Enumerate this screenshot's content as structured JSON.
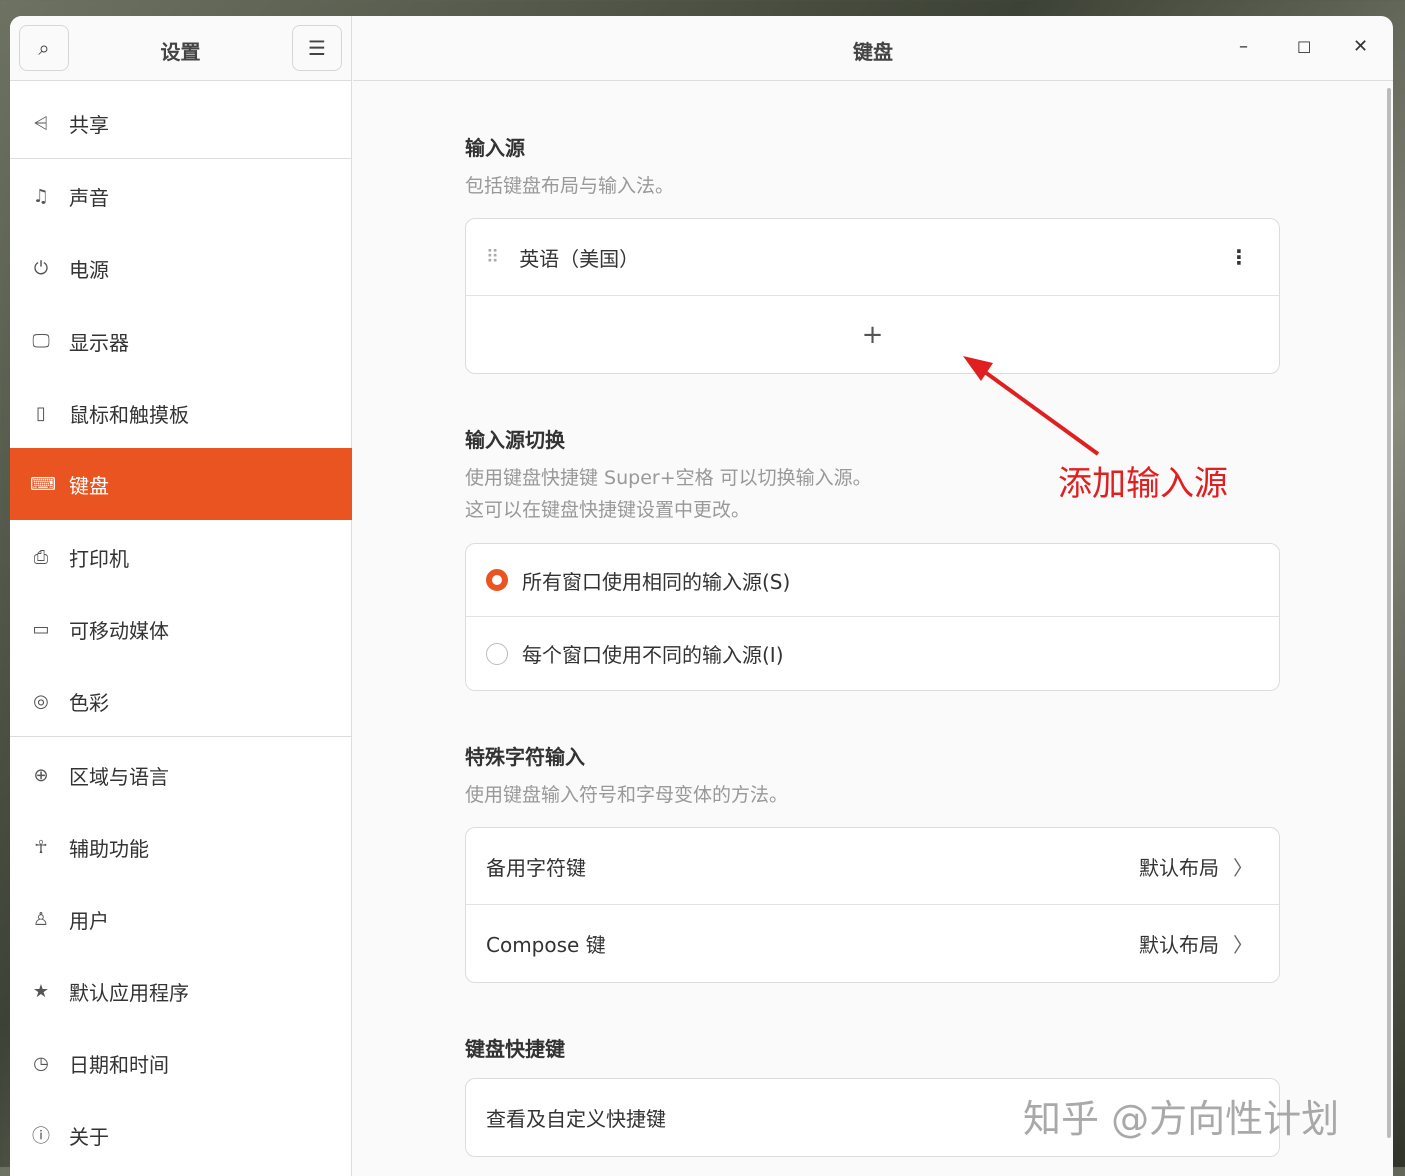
{
  "sidebar": {
    "title": "设置",
    "items": [
      {
        "label": "共享",
        "icon": "share-icon"
      },
      {
        "label": "声音",
        "icon": "music-note-icon"
      },
      {
        "label": "电源",
        "icon": "power-icon"
      },
      {
        "label": "显示器",
        "icon": "display-icon"
      },
      {
        "label": "鼠标和触摸板",
        "icon": "mouse-icon"
      },
      {
        "label": "键盘",
        "icon": "keyboard-icon",
        "selected": true
      },
      {
        "label": "打印机",
        "icon": "printer-icon"
      },
      {
        "label": "可移动媒体",
        "icon": "removable-media-icon"
      },
      {
        "label": "色彩",
        "icon": "color-icon"
      },
      {
        "label": "区域与语言",
        "icon": "globe-icon"
      },
      {
        "label": "辅助功能",
        "icon": "accessibility-icon"
      },
      {
        "label": "用户",
        "icon": "user-icon"
      },
      {
        "label": "默认应用程序",
        "icon": "star-icon"
      },
      {
        "label": "日期和时间",
        "icon": "clock-icon"
      },
      {
        "label": "关于",
        "icon": "info-icon"
      }
    ]
  },
  "header": {
    "title": "键盘"
  },
  "input_sources": {
    "title": "输入源",
    "desc": "包括键盘布局与输入法。",
    "items": [
      "英语（美国）"
    ],
    "add": "+"
  },
  "switching": {
    "title": "输入源切换",
    "desc1": "使用键盘快捷键 Super+空格 可以切换输入源。",
    "desc2": "这可以在键盘快捷键设置中更改。",
    "options": [
      "所有窗口使用相同的输入源(S)",
      "每个窗口使用不同的输入源(I)"
    ],
    "selected": 0
  },
  "special": {
    "title": "特殊字符输入",
    "desc": "使用键盘输入符号和字母变体的方法。",
    "rows": [
      {
        "label": "备用字符键",
        "value": "默认布局"
      },
      {
        "label": "Compose 键",
        "value": "默认布局"
      }
    ]
  },
  "shortcuts": {
    "title": "键盘快捷键",
    "row": "查看及自定义快捷键"
  },
  "annotation": {
    "text": "添加输入源",
    "color": "#e02020"
  },
  "watermark": "知乎 @方向性计划",
  "accent": "#e95420"
}
